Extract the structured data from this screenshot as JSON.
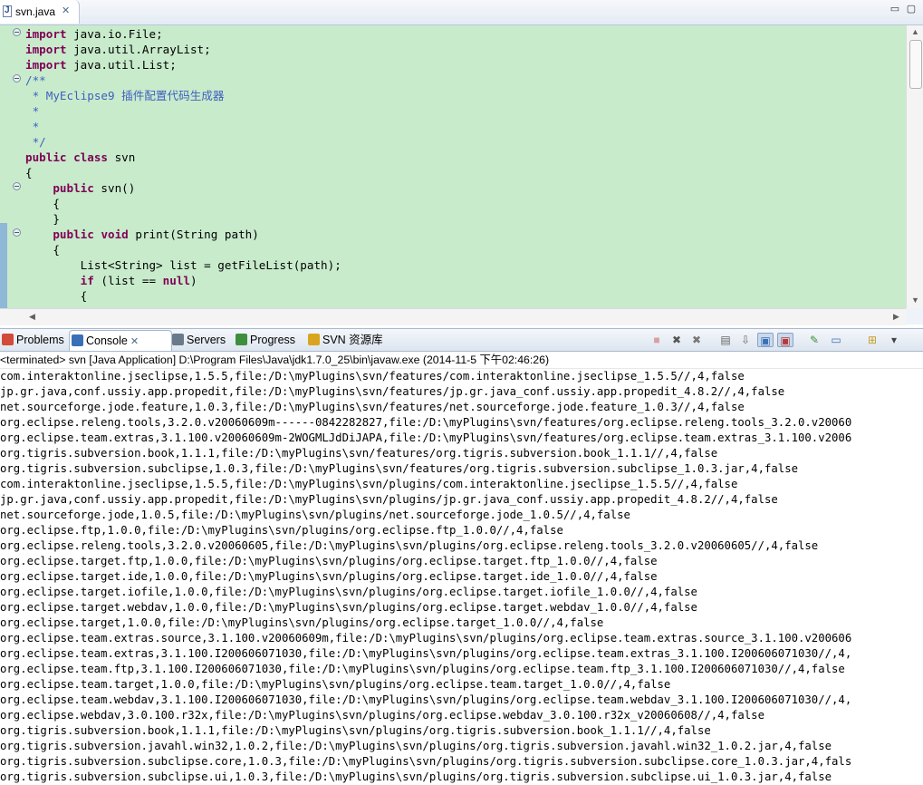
{
  "editor": {
    "tab_label": "svn.java",
    "tab_close": "✕",
    "min_button": "▭",
    "max_button": "▢",
    "code_lines": [
      [
        {
          "t": "import",
          "c": "kw"
        },
        {
          "t": " java.io.File;"
        }
      ],
      [
        {
          "t": "import",
          "c": "kw"
        },
        {
          "t": " java.util.ArrayList;"
        }
      ],
      [
        {
          "t": "import",
          "c": "kw"
        },
        {
          "t": " java.util.List;"
        }
      ],
      [
        {
          "t": "/**",
          "c": "cm"
        }
      ],
      [
        {
          "t": " * MyEclipse9 插件配置代码生成器",
          "c": "cm"
        }
      ],
      [
        {
          "t": " *",
          "c": "cm"
        }
      ],
      [
        {
          "t": " *",
          "c": "cm"
        }
      ],
      [
        {
          "t": " */",
          "c": "cm"
        }
      ],
      [
        {
          "t": "public",
          "c": "kw"
        },
        {
          "t": " "
        },
        {
          "t": "class",
          "c": "kw"
        },
        {
          "t": " svn"
        }
      ],
      [
        {
          "t": "{"
        }
      ],
      [
        {
          "t": "    "
        },
        {
          "t": "public",
          "c": "kw"
        },
        {
          "t": " svn()"
        }
      ],
      [
        {
          "t": "    {"
        }
      ],
      [
        {
          "t": "    }"
        }
      ],
      [
        {
          "t": "    "
        },
        {
          "t": "public",
          "c": "kw"
        },
        {
          "t": " "
        },
        {
          "t": "void",
          "c": "kw"
        },
        {
          "t": " print(String path)"
        }
      ],
      [
        {
          "t": "    {"
        }
      ],
      [
        {
          "t": "        List<String> list = getFileList(path);"
        }
      ],
      [
        {
          "t": "        "
        },
        {
          "t": "if",
          "c": "kw"
        },
        {
          "t": " (list == "
        },
        {
          "t": "null",
          "c": "kw"
        },
        {
          "t": ")"
        }
      ],
      [
        {
          "t": "        {"
        }
      ]
    ]
  },
  "console_view": {
    "tabs": [
      {
        "label": "Problems",
        "icon": "problems-icon",
        "color": "#d24a3a"
      },
      {
        "label": "Console",
        "icon": "console-icon",
        "color": "#3a6fb5",
        "close": "✕"
      },
      {
        "label": "Servers",
        "icon": "servers-icon",
        "color": "#6a7a8a"
      },
      {
        "label": "Progress",
        "icon": "progress-icon",
        "color": "#3d8f3d"
      },
      {
        "label": "SVN 资源库",
        "icon": "svn-repo-icon",
        "color": "#d9a520"
      }
    ],
    "toolbar": [
      {
        "name": "terminate-icon",
        "glyph": "■",
        "color": "#d9a0a0"
      },
      {
        "name": "remove-launch-icon",
        "glyph": "✖",
        "color": "#555"
      },
      {
        "name": "remove-all-icon",
        "glyph": "✖",
        "color": "#777"
      },
      {
        "name": "clear-console-icon",
        "glyph": "▤",
        "color": "#666"
      },
      {
        "name": "scroll-lock-icon",
        "glyph": "⇩",
        "color": "#666"
      },
      {
        "name": "show-stdout-icon",
        "glyph": "▣",
        "color": "#3a6fb5"
      },
      {
        "name": "show-stderr-icon",
        "glyph": "▣",
        "color": "#b53a3a"
      },
      {
        "name": "pin-console-icon",
        "glyph": "✎",
        "color": "#3d8f3d"
      },
      {
        "name": "display-console-icon",
        "glyph": "▭",
        "color": "#3a6fb5"
      },
      {
        "name": "open-console-icon",
        "glyph": "⊞",
        "color": "#c7a020"
      },
      {
        "name": "view-menu-icon",
        "glyph": "▾",
        "color": "#444"
      }
    ],
    "terminated_label": "<terminated> svn [Java Application] D:\\Program Files\\Java\\jdk1.7.0_25\\bin\\javaw.exe (2014-11-5 下午02:46:26)",
    "output_lines": [
      "com.interaktonline.jseclipse,1.5.5,file:/D:\\myPlugins\\svn/features/com.interaktonline.jseclipse_1.5.5//,4,false",
      "jp.gr.java,conf.ussiy.app.propedit,file:/D:\\myPlugins\\svn/features/jp.gr.java_conf.ussiy.app.propedit_4.8.2//,4,false",
      "net.sourceforge.jode.feature,1.0.3,file:/D:\\myPlugins\\svn/features/net.sourceforge.jode.feature_1.0.3//,4,false",
      "org.eclipse.releng.tools,3.2.0.v20060609m------0842282827,file:/D:\\myPlugins\\svn/features/org.eclipse.releng.tools_3.2.0.v20060",
      "org.eclipse.team.extras,3.1.100.v20060609m-2WOGMLJdDiJAPA,file:/D:\\myPlugins\\svn/features/org.eclipse.team.extras_3.1.100.v2006",
      "org.tigris.subversion.book,1.1.1,file:/D:\\myPlugins\\svn/features/org.tigris.subversion.book_1.1.1//,4,false",
      "org.tigris.subversion.subclipse,1.0.3,file:/D:\\myPlugins\\svn/features/org.tigris.subversion.subclipse_1.0.3.jar,4,false",
      "com.interaktonline.jseclipse,1.5.5,file:/D:\\myPlugins\\svn/plugins/com.interaktonline.jseclipse_1.5.5//,4,false",
      "jp.gr.java,conf.ussiy.app.propedit,file:/D:\\myPlugins\\svn/plugins/jp.gr.java_conf.ussiy.app.propedit_4.8.2//,4,false",
      "net.sourceforge.jode,1.0.5,file:/D:\\myPlugins\\svn/plugins/net.sourceforge.jode_1.0.5//,4,false",
      "org.eclipse.ftp,1.0.0,file:/D:\\myPlugins\\svn/plugins/org.eclipse.ftp_1.0.0//,4,false",
      "org.eclipse.releng.tools,3.2.0.v20060605,file:/D:\\myPlugins\\svn/plugins/org.eclipse.releng.tools_3.2.0.v20060605//,4,false",
      "org.eclipse.target.ftp,1.0.0,file:/D:\\myPlugins\\svn/plugins/org.eclipse.target.ftp_1.0.0//,4,false",
      "org.eclipse.target.ide,1.0.0,file:/D:\\myPlugins\\svn/plugins/org.eclipse.target.ide_1.0.0//,4,false",
      "org.eclipse.target.iofile,1.0.0,file:/D:\\myPlugins\\svn/plugins/org.eclipse.target.iofile_1.0.0//,4,false",
      "org.eclipse.target.webdav,1.0.0,file:/D:\\myPlugins\\svn/plugins/org.eclipse.target.webdav_1.0.0//,4,false",
      "org.eclipse.target,1.0.0,file:/D:\\myPlugins\\svn/plugins/org.eclipse.target_1.0.0//,4,false",
      "org.eclipse.team.extras.source,3.1.100.v20060609m,file:/D:\\myPlugins\\svn/plugins/org.eclipse.team.extras.source_3.1.100.v200606",
      "org.eclipse.team.extras,3.1.100.I200606071030,file:/D:\\myPlugins\\svn/plugins/org.eclipse.team.extras_3.1.100.I200606071030//,4,",
      "org.eclipse.team.ftp,3.1.100.I200606071030,file:/D:\\myPlugins\\svn/plugins/org.eclipse.team.ftp_3.1.100.I200606071030//,4,false",
      "org.eclipse.team.target,1.0.0,file:/D:\\myPlugins\\svn/plugins/org.eclipse.team.target_1.0.0//,4,false",
      "org.eclipse.team.webdav,3.1.100.I200606071030,file:/D:\\myPlugins\\svn/plugins/org.eclipse.team.webdav_3.1.100.I200606071030//,4,",
      "org.eclipse.webdav,3.0.100.r32x,file:/D:\\myPlugins\\svn/plugins/org.eclipse.webdav_3.0.100.r32x_v20060608//,4,false",
      "org.tigris.subversion.book,1.1.1,file:/D:\\myPlugins\\svn/plugins/org.tigris.subversion.book_1.1.1//,4,false",
      "org.tigris.subversion.javahl.win32,1.0.2,file:/D:\\myPlugins\\svn/plugins/org.tigris.subversion.javahl.win32_1.0.2.jar,4,false",
      "org.tigris.subversion.subclipse.core,1.0.3,file:/D:\\myPlugins\\svn/plugins/org.tigris.subversion.subclipse.core_1.0.3.jar,4,fals",
      "org.tigris.subversion.subclipse.ui,1.0.3,file:/D:\\myPlugins\\svn/plugins/org.tigris.subversion.subclipse.ui_1.0.3.jar,4,false"
    ]
  }
}
